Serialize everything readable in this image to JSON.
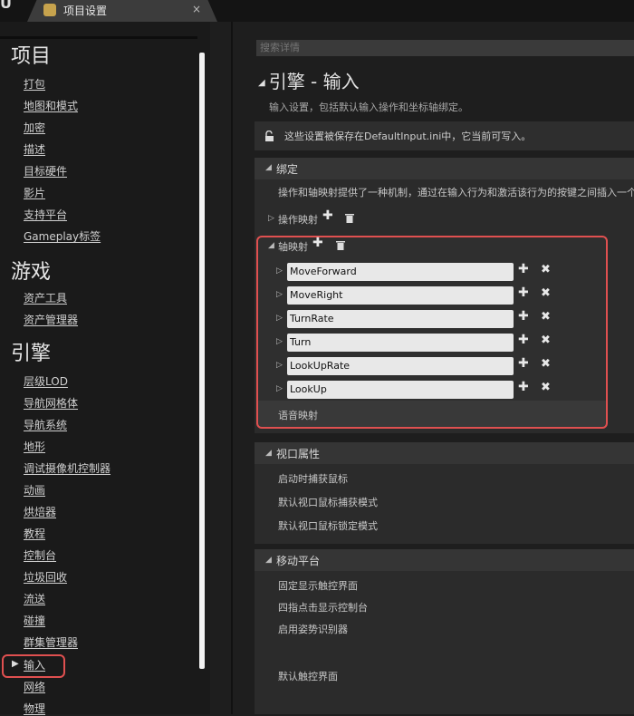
{
  "tab": {
    "title": "项目设置",
    "close": "×"
  },
  "sidebar": {
    "sections": [
      {
        "title": "项目",
        "items": [
          "打包",
          "地图和模式",
          "加密",
          "描述",
          "目标硬件",
          "影片",
          "支持平台",
          "Gameplay标签"
        ]
      },
      {
        "title": "游戏",
        "items": [
          "资产工具",
          "资产管理器"
        ]
      },
      {
        "title": "引擎",
        "items": [
          "层级LOD",
          "导航网格体",
          "导航系统",
          "地形",
          "调试摄像机控制器",
          "动画",
          "烘焙器",
          "教程",
          "控制台",
          "垃圾回收",
          "流送",
          "碰撞",
          "群集管理器",
          "输入",
          "网络",
          "物理"
        ]
      }
    ],
    "active_item": "输入"
  },
  "search": {
    "placeholder": "搜索详情"
  },
  "page": {
    "title": "引擎 - 输入",
    "description": "输入设置，包括默认输入操作和坐标轴绑定。",
    "notice": "这些设置被保存在DefaultInput.ini中，它当前可写入。"
  },
  "bindings": {
    "title": "绑定",
    "description": "操作和轴映射提供了一种机制，通过在输入行为和激活该行为的按键之间插入一个",
    "action_mappings_label": "操作映射",
    "axis_mappings_label": "轴映射",
    "axis_mappings": [
      "MoveForward",
      "MoveRight",
      "TurnRate",
      "Turn",
      "LookUpRate",
      "LookUp"
    ],
    "speech_mappings_label": "语音映射"
  },
  "viewport": {
    "title": "视口属性",
    "props": [
      "启动时捕获鼠标",
      "默认视口鼠标捕获模式",
      "默认视口鼠标锁定模式"
    ]
  },
  "mobile": {
    "title": "移动平台",
    "props": [
      "固定显示触控界面",
      "四指点击显示控制台",
      "启用姿势识别器",
      "默认触控界面"
    ]
  },
  "colors": {
    "highlight": "#e05050",
    "accent": "#c7a34d"
  }
}
